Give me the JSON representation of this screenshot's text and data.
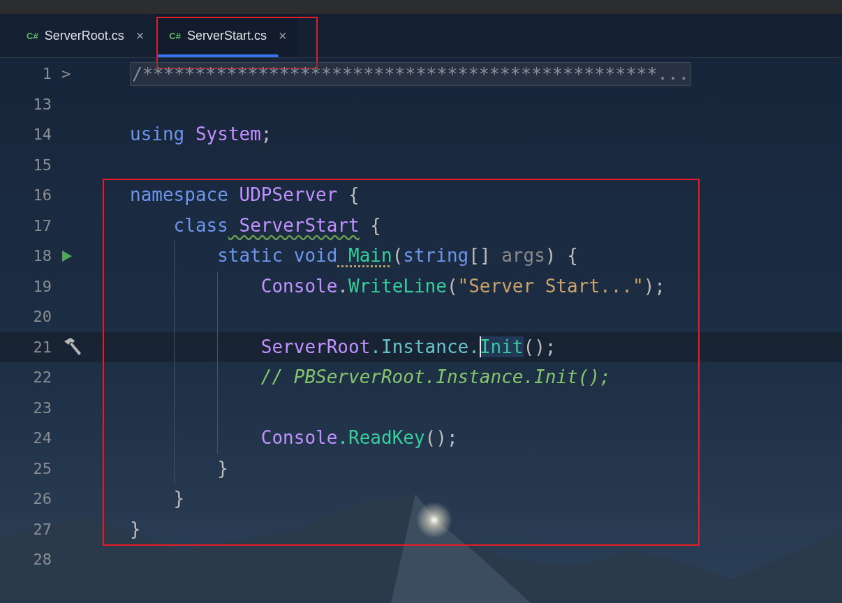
{
  "tabs": [
    {
      "icon_text": "C#",
      "label": "ServerRoot.cs",
      "close": "×",
      "selected": false,
      "boxed": false
    },
    {
      "icon_text": "C#",
      "label": "ServerStart.cs",
      "close": "×",
      "selected": true,
      "boxed": true
    }
  ],
  "editor": {
    "sections": [
      {
        "boxed": false,
        "lines": [
          {
            "number": "1",
            "folded": true,
            "fold_marker": ">",
            "current": false,
            "tokens": [
              {
                "kind": "folded",
                "text": "/*************************************************..."
              }
            ]
          },
          {
            "number": "13",
            "current": false
          },
          {
            "number": "14",
            "current": false,
            "tokens": [
              {
                "kind": "keyword",
                "text": "using"
              },
              {
                "kind": "type",
                "text": " System"
              },
              {
                "kind": "plain",
                "text": ";"
              }
            ]
          },
          {
            "number": "15",
            "current": false
          }
        ]
      },
      {
        "boxed": true,
        "lines": [
          {
            "number": "16",
            "current": false,
            "tokens": [
              {
                "kind": "keyword",
                "text": "namespace"
              },
              {
                "kind": "type",
                "text": " UDPServer"
              },
              {
                "kind": "plain",
                "text": " {"
              }
            ],
            "children": [
              {
                "number": "17",
                "current": false,
                "tokens": [
                  {
                    "kind": "keyword",
                    "text": "class"
                  },
                  {
                    "kind": "type",
                    "text": " ServerStart",
                    "warning": true
                  },
                  {
                    "kind": "plain",
                    "text": " {"
                  }
                ],
                "children": [
                  {
                    "number": "18",
                    "current": false,
                    "gutter": {
                      "kind": "run"
                    },
                    "tokens": [
                      {
                        "kind": "keyword",
                        "text": "static void"
                      },
                      {
                        "kind": "method",
                        "text": " Main",
                        "hint": true
                      },
                      {
                        "kind": "plain",
                        "text": "("
                      },
                      {
                        "kind": "keyword",
                        "text": "string"
                      },
                      {
                        "kind": "plain",
                        "text": "[] "
                      },
                      {
                        "kind": "param",
                        "text": "args"
                      },
                      {
                        "kind": "plain",
                        "text": ") {"
                      }
                    ],
                    "children": [
                      {
                        "number": "19",
                        "current": false,
                        "tokens": [
                          {
                            "kind": "type",
                            "text": "Console"
                          },
                          {
                            "kind": "plain",
                            "text": "."
                          },
                          {
                            "kind": "method",
                            "text": "WriteLine"
                          },
                          {
                            "kind": "plain",
                            "text": "("
                          },
                          {
                            "kind": "string",
                            "text": "\"Server Start...\""
                          },
                          {
                            "kind": "plain",
                            "text": ");"
                          }
                        ]
                      },
                      {
                        "number": "20",
                        "current": false
                      },
                      {
                        "number": "21",
                        "current": true,
                        "gutter": {
                          "kind": "build"
                        },
                        "tokens": [
                          {
                            "kind": "type",
                            "text": "ServerRoot"
                          },
                          {
                            "kind": "property",
                            "text": ".Instance."
                          },
                          {
                            "kind": "method",
                            "text": "Init",
                            "caret_before": true,
                            "highlighted": true
                          },
                          {
                            "kind": "plain",
                            "text": "();"
                          }
                        ]
                      },
                      {
                        "number": "22",
                        "current": false,
                        "tokens": [
                          {
                            "kind": "comment",
                            "text": "// PBServerRoot.Instance.Init();"
                          }
                        ]
                      },
                      {
                        "number": "23",
                        "current": false
                      },
                      {
                        "number": "24",
                        "current": false,
                        "tokens": [
                          {
                            "kind": "type",
                            "text": "Console"
                          },
                          {
                            "kind": "method",
                            "text": ".ReadKey"
                          },
                          {
                            "kind": "plain",
                            "text": "();"
                          }
                        ]
                      }
                    ]
                  },
                  {
                    "number": "25",
                    "current": false,
                    "tokens": [
                      {
                        "kind": "plain",
                        "text": "}"
                      }
                    ]
                  }
                ]
              },
              {
                "number": "26",
                "current": false,
                "tokens": [
                  {
                    "kind": "plain",
                    "text": "}"
                  }
                ]
              }
            ]
          },
          {
            "number": "27",
            "current": false,
            "tokens": [
              {
                "kind": "plain",
                "text": "}"
              }
            ]
          }
        ]
      },
      {
        "boxed": false,
        "lines": [
          {
            "number": "28",
            "current": false
          }
        ]
      }
    ]
  }
}
